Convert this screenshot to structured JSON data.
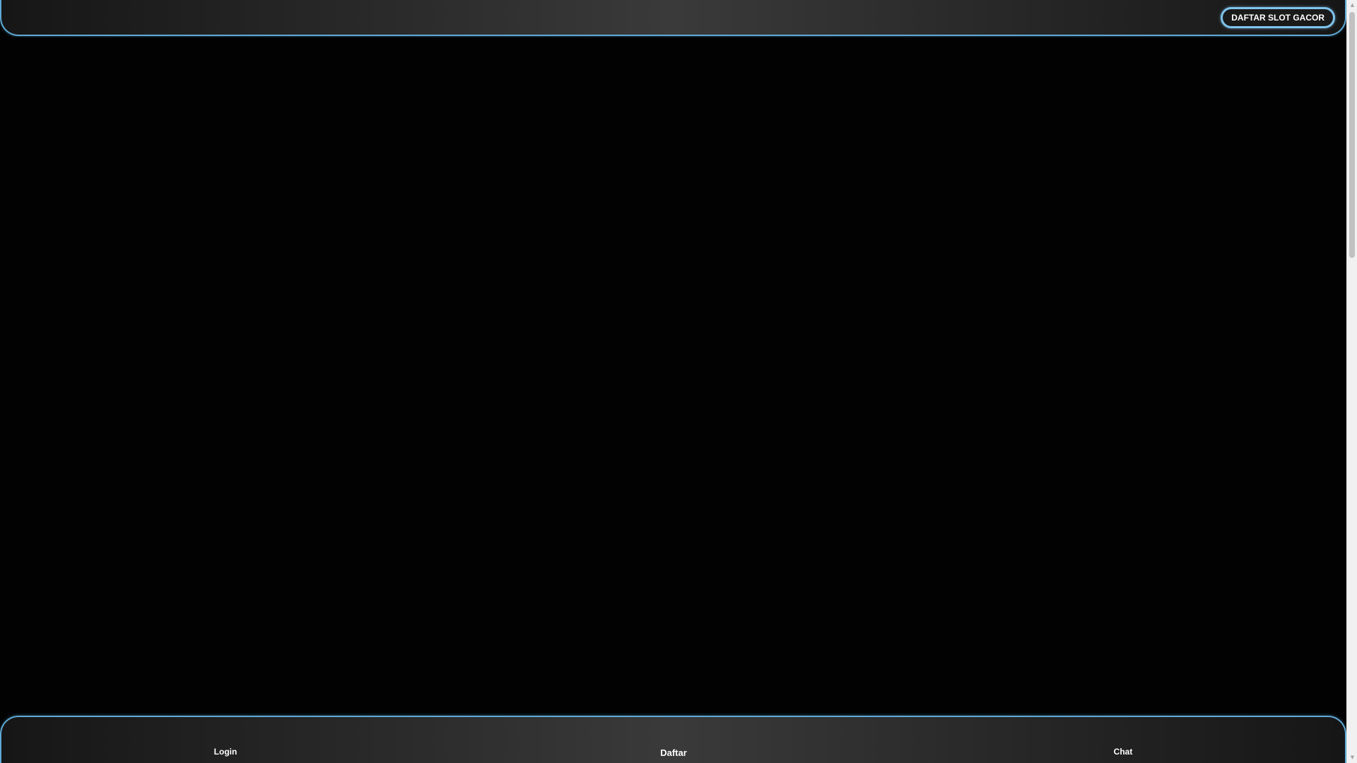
{
  "header": {
    "cta_label": "DAFTAR SLOT GACOR"
  },
  "bottom_nav": {
    "items": [
      {
        "label": "Login"
      },
      {
        "label": "Daftar"
      },
      {
        "label": "Chat"
      }
    ]
  },
  "scrollbar": {
    "up_icon": "scroll-up-arrow-icon",
    "down_icon": "scroll-down-arrow-icon",
    "position_fraction": 0.0,
    "visible_fraction": 0.33
  },
  "colors": {
    "accent": "#5fa9d6",
    "button_border": "#7fc3ec",
    "background": "#020202",
    "bar_gradient_center": "#3a3a3a",
    "text": "#ffffff"
  }
}
